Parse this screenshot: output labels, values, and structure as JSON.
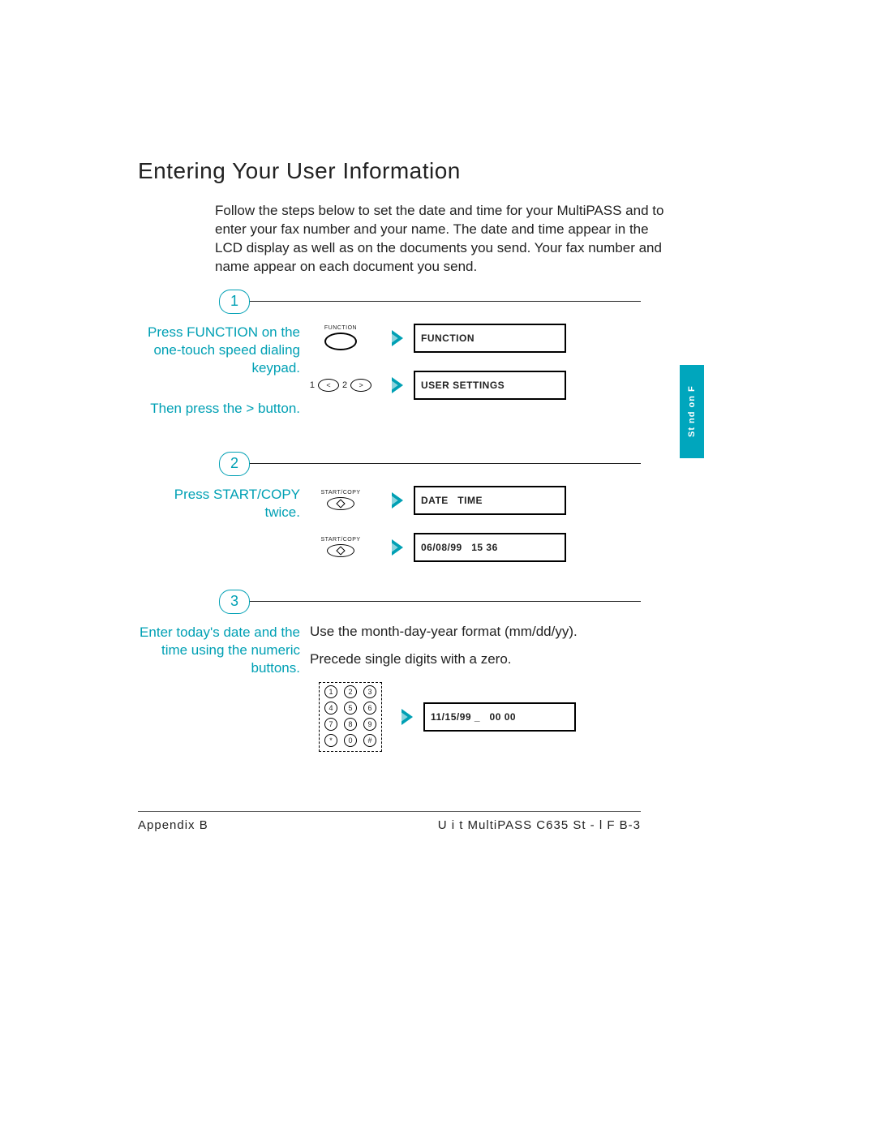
{
  "title": "Entering Your User Information",
  "intro": "Follow the steps below to set the date and time for your MultiPASS and to enter your fax number and your name. The date and time appear in the LCD display as well as on the documents you send. Your fax number and name appear on each document you send.",
  "step1": {
    "num": "1",
    "side_a": "Press FUNCTION on the one-touch speed dialing keypad.",
    "side_b": "Then press the > button.",
    "btn_label": "FUNCTION",
    "arrow_left": "<",
    "arrow_right": ">",
    "pair_1": "1",
    "pair_2": "2",
    "lcd_a": "FUNCTION",
    "lcd_b": "USER SETTINGS"
  },
  "step2": {
    "num": "2",
    "side": "Press START/COPY twice.",
    "btn_label": "START/COPY",
    "lcd_a": "DATE   TIME",
    "lcd_b": "06/08/99   15 36"
  },
  "step3": {
    "num": "3",
    "side": "Enter today's date and the time using the numeric buttons.",
    "body_a": "Use the month-day-year format (mm/dd/yy).",
    "body_b": "Precede single digits with a zero.",
    "lcd": "11/15/99 _   00 00",
    "keys": [
      "1",
      "2",
      "3",
      "4",
      "5",
      "6",
      "7",
      "8",
      "9",
      "*",
      "0",
      "#"
    ]
  },
  "side_tab": "St  nd  on  F",
  "footer": {
    "left": "Appendix B",
    "center": "U i   t   MultiPASS C635      St    - l    F B-3"
  }
}
